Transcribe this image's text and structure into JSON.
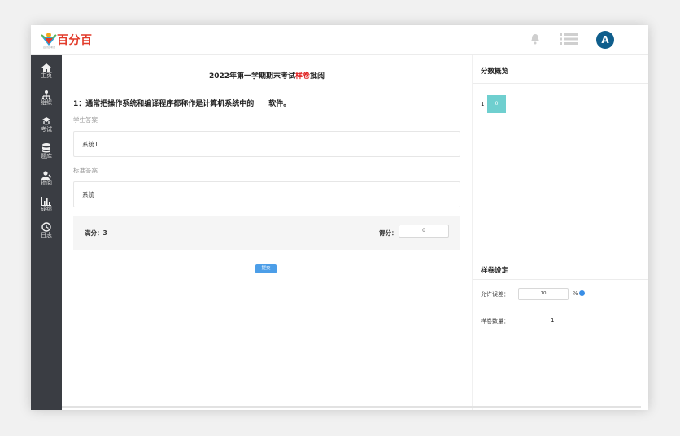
{
  "brand": {
    "name": "百分百",
    "tagline": "百分百考试"
  },
  "user": {
    "avatar_letter": "A"
  },
  "sidebar": {
    "items": [
      {
        "label": "主页",
        "icon": "home-icon"
      },
      {
        "label": "组织",
        "icon": "org-icon"
      },
      {
        "label": "考试",
        "icon": "exam-icon"
      },
      {
        "label": "题库",
        "icon": "database-icon"
      },
      {
        "label": "批阅",
        "icon": "review-icon"
      },
      {
        "label": "成绩",
        "icon": "chart-icon"
      },
      {
        "label": "日志",
        "icon": "clock-icon"
      }
    ]
  },
  "main": {
    "title_prefix": "2022年第一学期期末考试",
    "title_highlight": "样卷",
    "title_suffix": "批阅",
    "question": "1：通常把操作系统和编译程序都称作是计算机系统中的____软件。",
    "student_answer_label": "学生答案",
    "student_answer": "系统1",
    "standard_answer_label": "标准答案",
    "standard_answer": "系统",
    "full_score_label": "满分：3",
    "get_score_label": "得分：",
    "score_value": "0",
    "submit_label": "提交"
  },
  "right": {
    "overview_title": "分数概览",
    "overview_index": "1",
    "overview_cell_value": "0",
    "settings_title": "样卷设定",
    "ratio_label": "允许误差：",
    "ratio_value": "10",
    "ratio_unit": "%",
    "count_label": "样卷数量：",
    "count_value": "1"
  },
  "colors": {
    "accent": "#e02020",
    "sidebar": "#3a3d43",
    "avatar": "#0f5e8c",
    "overview_cell": "#6fcfcf",
    "button": "#4c9ee8"
  }
}
